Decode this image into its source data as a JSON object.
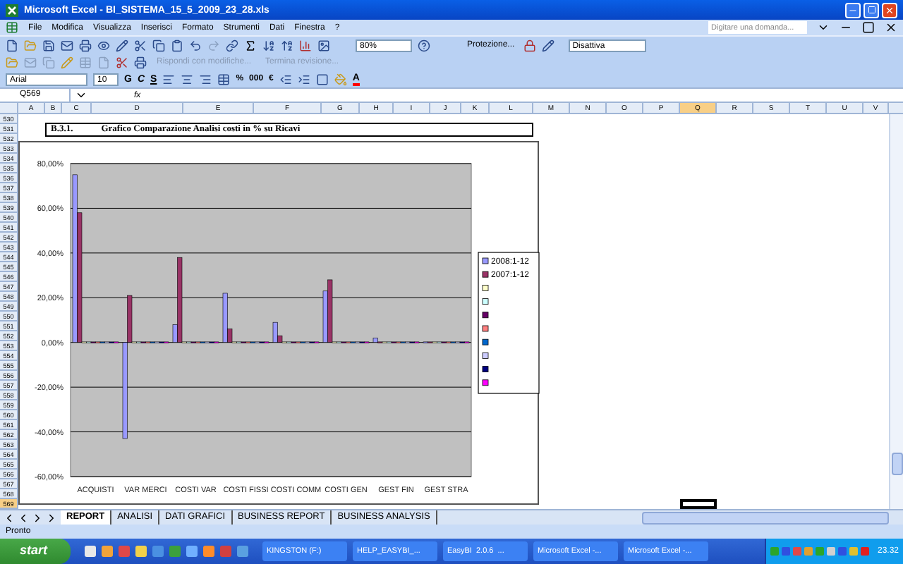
{
  "window": {
    "title": "Microsoft Excel - BI_SISTEMA_15_5_2009_23_28.xls"
  },
  "menu": [
    "File",
    "Modifica",
    "Visualizza",
    "Inserisci",
    "Formato",
    "Strumenti",
    "Dati",
    "Finestra",
    "?"
  ],
  "help_box": {
    "placeholder": "Digitare una domanda..."
  },
  "toolbar": {
    "zoom": "80%",
    "protection": "Protezione...",
    "dropdown": "Disattiva"
  },
  "review_toolbar": [
    {
      "label": "Rispondi con modifiche...",
      "disabled": true
    },
    {
      "label": "Termina revisione...",
      "disabled": true
    }
  ],
  "format_toolbar": {
    "font": "Arial",
    "size": "10",
    "style_buttons": [
      "G",
      "C",
      "S"
    ],
    "number_buttons": [
      "%",
      "000",
      "€"
    ],
    "font_color": "A"
  },
  "formula_bar": {
    "name_box": "Q569",
    "fx": "fx"
  },
  "columns": [
    {
      "label": "A",
      "selected": false
    },
    {
      "label": "B",
      "selected": false
    },
    {
      "label": "C",
      "selected": false
    },
    {
      "label": "D",
      "selected": false
    },
    {
      "label": "E",
      "selected": false
    },
    {
      "label": "F",
      "selected": false
    },
    {
      "label": "G",
      "selected": false
    },
    {
      "label": "H",
      "selected": false
    },
    {
      "label": "I",
      "selected": false
    },
    {
      "label": "J",
      "selected": false
    },
    {
      "label": "K",
      "selected": false
    },
    {
      "label": "L",
      "selected": false
    },
    {
      "label": "M",
      "selected": false
    },
    {
      "label": "N",
      "selected": false
    },
    {
      "label": "O",
      "selected": false
    },
    {
      "label": "P",
      "selected": false
    },
    {
      "label": "Q",
      "selected": true
    },
    {
      "label": "R",
      "selected": false
    },
    {
      "label": "S",
      "selected": false
    },
    {
      "label": "T",
      "selected": false
    },
    {
      "label": "U",
      "selected": false
    },
    {
      "label": "V",
      "selected": false
    }
  ],
  "rows": [
    {
      "label": "530",
      "selected": false
    },
    {
      "label": "531",
      "selected": false
    },
    {
      "label": "532",
      "selected": false
    },
    {
      "label": "533",
      "selected": false
    },
    {
      "label": "534",
      "selected": false
    },
    {
      "label": "535",
      "selected": false
    },
    {
      "label": "536",
      "selected": false
    },
    {
      "label": "537",
      "selected": false
    },
    {
      "label": "538",
      "selected": false
    },
    {
      "label": "539",
      "selected": false
    },
    {
      "label": "540",
      "selected": false
    },
    {
      "label": "541",
      "selected": false
    },
    {
      "label": "542",
      "selected": false
    },
    {
      "label": "543",
      "selected": false
    },
    {
      "label": "544",
      "selected": false
    },
    {
      "label": "545",
      "selected": false
    },
    {
      "label": "546",
      "selected": false
    },
    {
      "label": "547",
      "selected": false
    },
    {
      "label": "548",
      "selected": false
    },
    {
      "label": "549",
      "selected": false
    },
    {
      "label": "550",
      "selected": false
    },
    {
      "label": "551",
      "selected": false
    },
    {
      "label": "552",
      "selected": false
    },
    {
      "label": "553",
      "selected": false
    },
    {
      "label": "554",
      "selected": false
    },
    {
      "label": "555",
      "selected": false
    },
    {
      "label": "556",
      "selected": false
    },
    {
      "label": "557",
      "selected": false
    },
    {
      "label": "558",
      "selected": false
    },
    {
      "label": "559",
      "selected": false
    },
    {
      "label": "560",
      "selected": false
    },
    {
      "label": "561",
      "selected": false
    },
    {
      "label": "562",
      "selected": false
    },
    {
      "label": "563",
      "selected": false
    },
    {
      "label": "564",
      "selected": false
    },
    {
      "label": "565",
      "selected": false
    },
    {
      "label": "566",
      "selected": false
    },
    {
      "label": "567",
      "selected": false
    },
    {
      "label": "568",
      "selected": false
    },
    {
      "label": "569",
      "selected": true
    }
  ],
  "sheet": {
    "heading_number": "B.3.1.",
    "heading_title": "Grafico Comparazione Analisi costi in % su Ricavi"
  },
  "chart_data": {
    "type": "bar",
    "grid": true,
    "legend": true,
    "categories": [
      "ACQUISTI",
      "VAR MERCI",
      "COSTI VAR",
      "COSTI FISSI",
      "COSTI COMM",
      "COSTI GEN",
      "GEST FIN",
      "GEST STRA"
    ],
    "series": [
      {
        "name": "2008:1-12",
        "color": "#9999ff",
        "values": [
          75,
          -43,
          8,
          22,
          9,
          23,
          2,
          0
        ]
      },
      {
        "name": "2007:1-12",
        "color": "#993366",
        "values": [
          58,
          21,
          38,
          6,
          3,
          28,
          0,
          0
        ]
      },
      {
        "color": "#ffffcc",
        "values": [
          0,
          0,
          0,
          0,
          0,
          0,
          0,
          0
        ]
      },
      {
        "color": "#ccffff",
        "values": [
          0,
          0,
          0,
          0,
          0,
          0,
          0,
          0
        ]
      },
      {
        "color": "#660066",
        "values": [
          0,
          0,
          0,
          0,
          0,
          0,
          0,
          0
        ]
      },
      {
        "color": "#ff8080",
        "values": [
          0,
          0,
          0,
          0,
          0,
          0,
          0,
          0
        ]
      },
      {
        "color": "#0066cc",
        "values": [
          0,
          0,
          0,
          0,
          0,
          0,
          0,
          0
        ]
      },
      {
        "color": "#ccccff",
        "values": [
          0,
          0,
          0,
          0,
          0,
          0,
          0,
          0
        ]
      },
      {
        "color": "#000080",
        "values": [
          0,
          0,
          0,
          0,
          0,
          0,
          0,
          0
        ]
      },
      {
        "color": "#ff00ff",
        "values": [
          0,
          0,
          0,
          0,
          0,
          0,
          0,
          0
        ]
      }
    ],
    "ylim": [
      -60,
      80
    ],
    "yticks": [
      {
        "value": 80,
        "label": "80,00%"
      },
      {
        "value": 60,
        "label": "60,00%"
      },
      {
        "value": 40,
        "label": "40,00%"
      },
      {
        "value": 20,
        "label": "20,00%"
      },
      {
        "value": 0,
        "label": "0,00%"
      },
      {
        "value": -20,
        "label": "-20,00%"
      },
      {
        "value": -40,
        "label": "-40,00%"
      },
      {
        "value": -60,
        "label": "-60,00%"
      }
    ]
  },
  "sheet_tabs": [
    {
      "label": "REPORT",
      "selected": true
    },
    {
      "label": "ANALISI",
      "selected": false
    },
    {
      "label": "DATI GRAFICI",
      "selected": false
    },
    {
      "label": "BUSINESS REPORT",
      "selected": false
    },
    {
      "label": "BUSINESS ANALYSIS",
      "selected": false
    }
  ],
  "status_bar": "Pronto",
  "taskbar": {
    "start": "start",
    "tasks": [
      "KINGSTON (F:)",
      "HELP_EASYBI_...",
      "EasyBI  2.0.6  ...",
      "Microsoft Excel -...",
      "Microsoft Excel -..."
    ],
    "clock": "23.32"
  }
}
